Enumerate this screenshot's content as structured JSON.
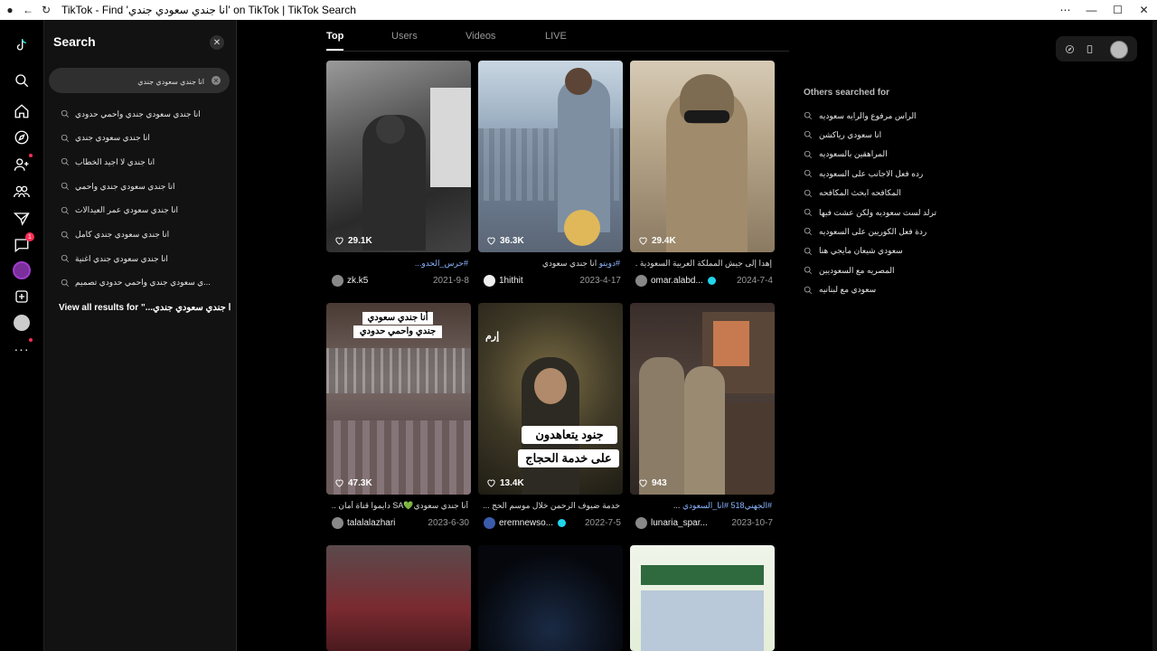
{
  "window": {
    "title": "TikTok - Find 'انا جندي سعودي جندي' on TikTok | TikTok Search"
  },
  "search": {
    "heading": "Search",
    "query": "انا جندي سعودي جندي",
    "suggestions": [
      "انا جندي سعودي جندي واحمي حدودي",
      "انا جندي سعودي جندي",
      "انا جندي لا اجيد الخطاب",
      "انا جندي سعودي جندي واحمي",
      "انا جندي سعودي عمر العيدالات",
      "انا جندي سعودي جندي كامل",
      "انا جندي سعودي جندي اغنية",
      "...ي سعودي جندي واحمي حدودي تصميم"
    ],
    "view_all": "View all results for \"...ا جندي سعودي جندي"
  },
  "tabs": [
    "Top",
    "Users",
    "Videos",
    "LIVE"
  ],
  "rail": {
    "messages_badge": "1"
  },
  "videos": [
    {
      "likes": "29.1K",
      "tag": "#حرس_الحدو...",
      "desc": "",
      "user": "zk.k5",
      "verified": false,
      "date": "2021-9-8"
    },
    {
      "likes": "36.3K",
      "tag": "#دويتو",
      "desc": "انا جندي سعودي",
      "user": "1hithit",
      "verified": false,
      "date": "2023-4-17"
    },
    {
      "likes": "29.4K",
      "tag": "",
      "desc": "إهدا إلى جيش المملكة العربية السعودية ....",
      "user": "omar.alabd...",
      "verified": true,
      "date": "2024-7-4"
    },
    {
      "likes": "47.3K",
      "tag": "",
      "desc": "أنا جندي سعودي💚SA دايموا قناة أمان ...",
      "user": "talalalazhari",
      "verified": false,
      "date": "2023-6-30"
    },
    {
      "likes": "13.4K",
      "tag": "",
      "desc": "خدمة ضيوف الرحمن خلال موسم الحج ...",
      "user": "eremnewso...",
      "verified": true,
      "date": "2022-7-5"
    },
    {
      "likes": "943",
      "tag": "#الجهني518 #انا_السعودي",
      "desc": "...",
      "user": "lunaria_spar...",
      "verified": false,
      "date": "2023-10-7"
    }
  ],
  "overlays": {
    "card4_line1": "أنا جندي سعودي",
    "card4_line2": "جندي واحمي حدودي",
    "card5_line1": "جنود يتعاهدون",
    "card5_line2": "على خدمة الحجاج",
    "card5_corner": "إرم"
  },
  "others": {
    "heading": "Others searched for",
    "items": [
      "الراس مرفوع والرايه سعوديه",
      "انا سعودي رياكشن",
      "المراهقين بالسعوديه",
      "رده فعل الاجانب على السعوديه",
      "المكافحه ابحث المكافحه",
      "ترلد لست سعوديه ولكن عشت فيها",
      "ردة فعل الكوريين على السعوديه",
      "سعودي شيعان مايجي هنا",
      "المصريه مع السعوديين",
      "سعودي مع لبنانيه"
    ]
  }
}
